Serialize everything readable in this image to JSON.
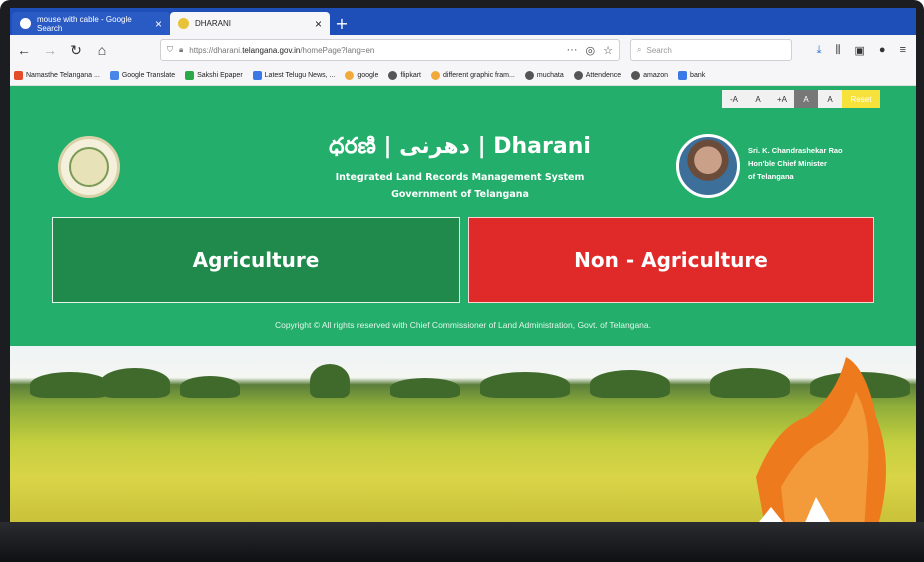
{
  "browser": {
    "tabs": [
      {
        "label": "mouse with cable - Google Search",
        "active": false
      },
      {
        "label": "DHARANI",
        "active": true
      }
    ],
    "url": {
      "prefix": "https://dharani.",
      "host": "telangana.gov.in",
      "path": "/homePage?lang=en"
    },
    "search_placeholder": "Search",
    "bookmarks": [
      {
        "label": "Namasthe Telangana ...",
        "color": "#e44b2b"
      },
      {
        "label": "Google Translate",
        "color": "#4a86e8"
      },
      {
        "label": "Sakshi Epaper",
        "color": "#2aa84a"
      },
      {
        "label": "Latest Telugu News, ...",
        "color": "#3b78e7"
      },
      {
        "label": "google",
        "color": "#f2a93b"
      },
      {
        "label": "flipkart",
        "color": "#555555"
      },
      {
        "label": "different graphic fram...",
        "color": "#f2a93b"
      },
      {
        "label": "muchata",
        "color": "#555555"
      },
      {
        "label": "Attendence",
        "color": "#555555"
      },
      {
        "label": "amazon",
        "color": "#555555"
      },
      {
        "label": "bank",
        "color": "#3b78e7"
      }
    ]
  },
  "accessibility": {
    "items": [
      "-A",
      "A",
      "+A",
      "A",
      "A"
    ],
    "reset_label": "Reset"
  },
  "site": {
    "title": "ధరణి | دھرنی | Dharani",
    "subtitle": "Integrated Land Records Management System",
    "government": "Government of Telangana",
    "cm_name": "Sri. K. Chandrashekar Rao",
    "cm_role1": "Hon'ble Chief Minister",
    "cm_role2": "of Telangana",
    "agriculture_label": "Agriculture",
    "non_agriculture_label": "Non - Agriculture",
    "copyright": "Copyright © All rights reserved with Chief Commissioner of Land Administration, Govt. of Telangana."
  },
  "colors": {
    "site_green": "#23ae6b",
    "agri_green": "#1f8a4c",
    "non_agri_red": "#e02a2a"
  }
}
